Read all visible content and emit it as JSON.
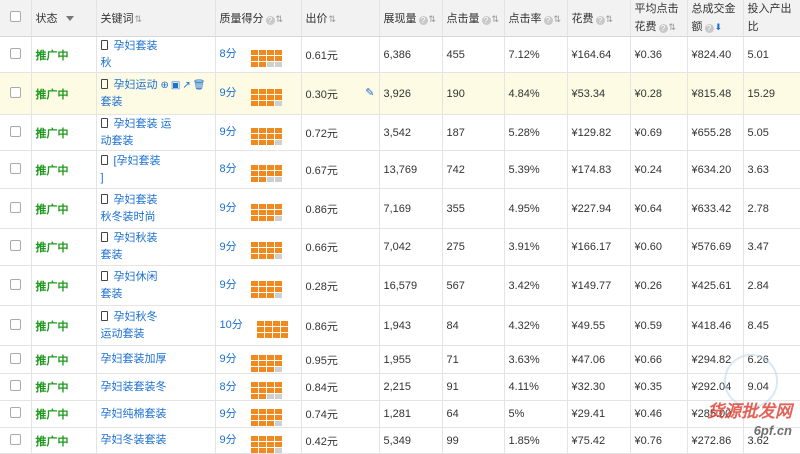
{
  "header": {
    "status_label": "状态",
    "keyword_label": "关键词",
    "quality_label": "质量得分",
    "price_label": "出价",
    "impressions_label": "展现量",
    "clicks_label": "点击量",
    "ctr_label": "点击率",
    "cost_label": "花费",
    "avg_cpc_label": "平均点击花费",
    "gmv_label": "总成交金额",
    "roi_label": "投入产出比"
  },
  "sort_glyph": "⇅",
  "sort_active_glyph": "⬇",
  "help_glyph": "?",
  "pencil_glyph": "✎",
  "tools_glyph": "⊕▣↗🗑",
  "colors": {
    "bar_filled": "#f08a1e",
    "bar_empty": "#cfcfcf",
    "status": "#1e9a1e",
    "link": "#1b6fd1"
  },
  "rows": [
    {
      "status": "推广中",
      "kw_line1": "孕妇套装",
      "kw_line2": "秋",
      "has_phone": true,
      "score": "8分",
      "score_level": 8,
      "price": "0.61元",
      "impressions": "6,386",
      "clicks": "455",
      "ctr": "7.12%",
      "cost": "¥164.64",
      "avg_cpc": "¥0.36",
      "gmv": "¥824.40",
      "roi": "5.01"
    },
    {
      "status": "推广中",
      "kw_line1": "孕妇运动",
      "kw_line2": "套装",
      "has_phone": true,
      "highlight": true,
      "score": "9分",
      "score_level": 9,
      "price": "0.30元",
      "impressions": "3,926",
      "clicks": "190",
      "ctr": "4.84%",
      "cost": "¥53.34",
      "avg_cpc": "¥0.28",
      "gmv": "¥815.48",
      "roi": "15.29"
    },
    {
      "status": "推广中",
      "kw_line1": "孕妇套装 运",
      "kw_line2": "动套装",
      "has_phone": true,
      "score": "9分",
      "score_level": 9,
      "price": "0.72元",
      "impressions": "3,542",
      "clicks": "187",
      "ctr": "5.28%",
      "cost": "¥129.82",
      "avg_cpc": "¥0.69",
      "gmv": "¥655.28",
      "roi": "5.05"
    },
    {
      "status": "推广中",
      "kw_line1": "[孕妇套装",
      "kw_line2": "]",
      "has_phone": true,
      "score": "8分",
      "score_level": 8,
      "price": "0.67元",
      "impressions": "13,769",
      "clicks": "742",
      "ctr": "5.39%",
      "cost": "¥174.83",
      "avg_cpc": "¥0.24",
      "gmv": "¥634.20",
      "roi": "3.63"
    },
    {
      "status": "推广中",
      "kw_line1": "孕妇套装",
      "kw_line2": "秋冬装时尚",
      "has_phone": true,
      "score": "9分",
      "score_level": 9,
      "price": "0.86元",
      "impressions": "7,169",
      "clicks": "355",
      "ctr": "4.95%",
      "cost": "¥227.94",
      "avg_cpc": "¥0.64",
      "gmv": "¥633.42",
      "roi": "2.78"
    },
    {
      "status": "推广中",
      "kw_line1": "孕妇秋装",
      "kw_line2": "套装",
      "has_phone": true,
      "score": "9分",
      "score_level": 9,
      "price": "0.66元",
      "impressions": "7,042",
      "clicks": "275",
      "ctr": "3.91%",
      "cost": "¥166.17",
      "avg_cpc": "¥0.60",
      "gmv": "¥576.69",
      "roi": "3.47"
    },
    {
      "status": "推广中",
      "kw_line1": "孕妇休闲",
      "kw_line2": "套装",
      "has_phone": true,
      "score": "9分",
      "score_level": 9,
      "price": "0.28元",
      "impressions": "16,579",
      "clicks": "567",
      "ctr": "3.42%",
      "cost": "¥149.77",
      "avg_cpc": "¥0.26",
      "gmv": "¥425.61",
      "roi": "2.84"
    },
    {
      "status": "推广中",
      "kw_line1": "孕妇秋冬",
      "kw_line2": "运动套装",
      "has_phone": true,
      "score": "10分",
      "score_level": 10,
      "price": "0.86元",
      "impressions": "1,943",
      "clicks": "84",
      "ctr": "4.32%",
      "cost": "¥49.55",
      "avg_cpc": "¥0.59",
      "gmv": "¥418.46",
      "roi": "8.45"
    },
    {
      "status": "推广中",
      "kw_line1": "孕妇套装加厚",
      "kw_line2": "",
      "has_phone": false,
      "score": "9分",
      "score_level": 9,
      "price": "0.95元",
      "impressions": "1,955",
      "clicks": "71",
      "ctr": "3.63%",
      "cost": "¥47.06",
      "avg_cpc": "¥0.66",
      "gmv": "¥294.82",
      "roi": "6.26"
    },
    {
      "status": "推广中",
      "kw_line1": "孕妇装套装冬",
      "kw_line2": "",
      "has_phone": false,
      "score": "8分",
      "score_level": 8,
      "price": "0.84元",
      "impressions": "2,215",
      "clicks": "91",
      "ctr": "4.11%",
      "cost": "¥32.30",
      "avg_cpc": "¥0.35",
      "gmv": "¥292.04",
      "roi": "9.04"
    },
    {
      "status": "推广中",
      "kw_line1": "孕妇纯棉套装",
      "kw_line2": "",
      "has_phone": false,
      "score": "9分",
      "score_level": 9,
      "price": "0.74元",
      "impressions": "1,281",
      "clicks": "64",
      "ctr": "5%",
      "cost": "¥29.41",
      "avg_cpc": "¥0.46",
      "gmv": "¥285.00",
      "roi": ""
    },
    {
      "status": "推广中",
      "kw_line1": "孕妇冬装套装",
      "kw_line2": "",
      "has_phone": false,
      "score": "9分",
      "score_level": 9,
      "price": "0.42元",
      "impressions": "5,349",
      "clicks": "99",
      "ctr": "1.85%",
      "cost": "¥75.42",
      "avg_cpc": "¥0.76",
      "gmv": "¥272.86",
      "roi": "3.62"
    }
  ],
  "watermark": {
    "line1": "货源批发网",
    "line2": "6pf.cn"
  }
}
